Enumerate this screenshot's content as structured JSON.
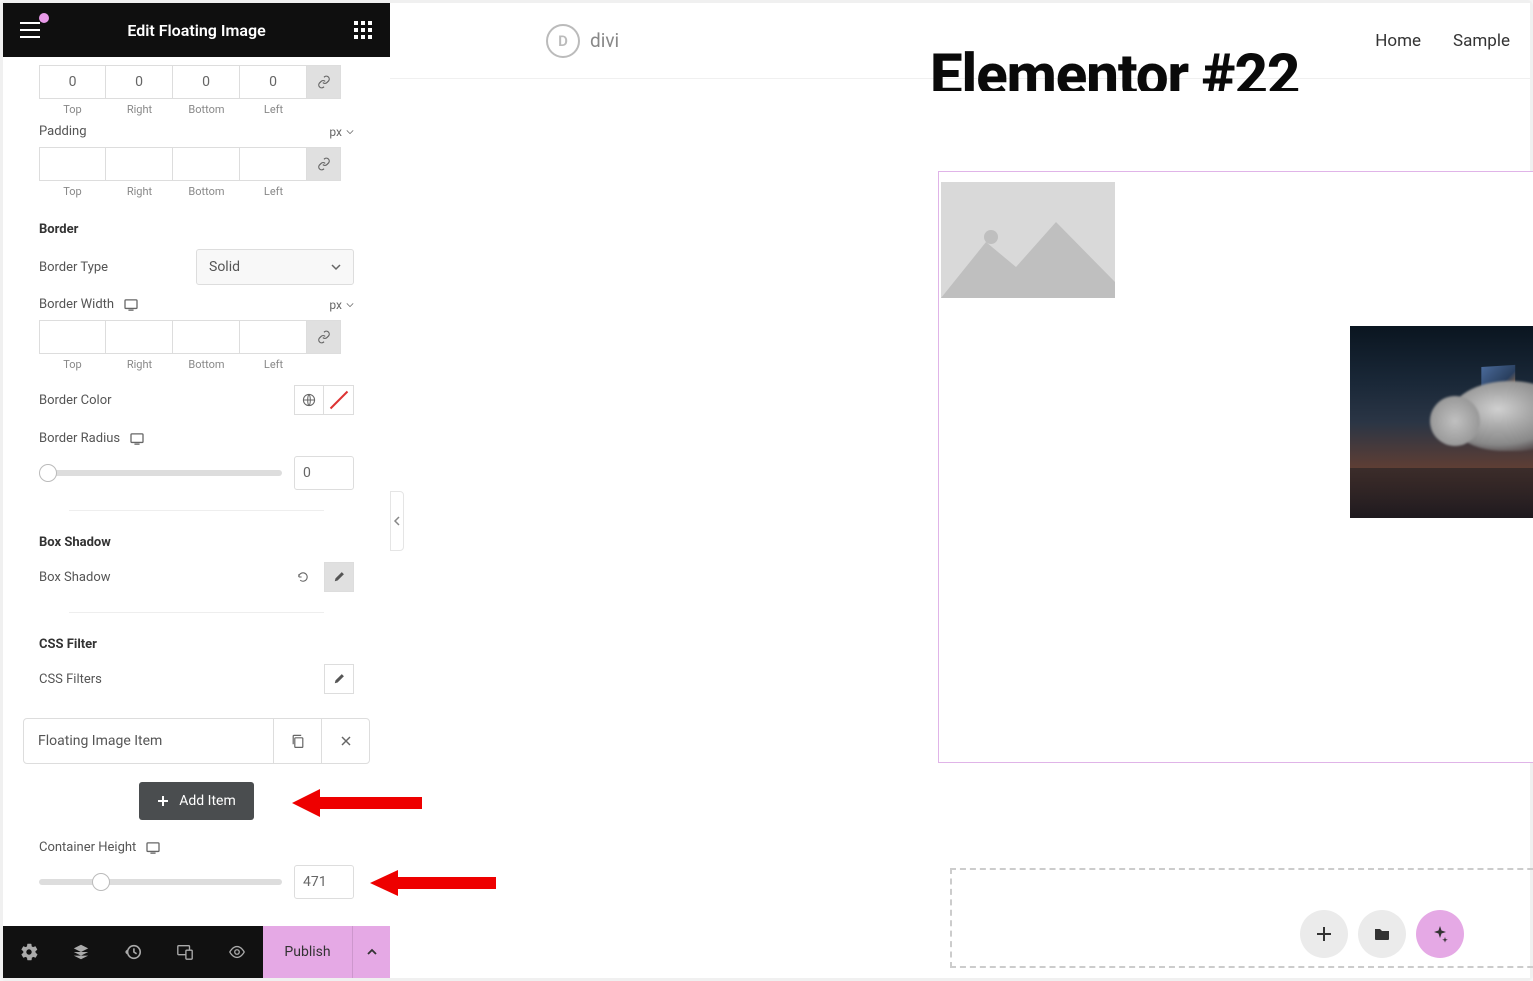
{
  "header": {
    "title": "Edit Floating Image"
  },
  "margin": {
    "top": "0",
    "right": "0",
    "bottom": "0",
    "left": "0",
    "labels": {
      "top": "Top",
      "right": "Right",
      "bottom": "Bottom",
      "left": "Left"
    }
  },
  "padding": {
    "label": "Padding",
    "unit": "px"
  },
  "border": {
    "title": "Border",
    "type_label": "Border Type",
    "type_value": "Solid",
    "width_label": "Border Width",
    "width_unit": "px",
    "color_label": "Border Color",
    "radius_label": "Border Radius",
    "radius_value": "0"
  },
  "boxshadow": {
    "title": "Box Shadow",
    "label": "Box Shadow"
  },
  "cssfilter": {
    "title": "CSS Filter",
    "label": "CSS Filters"
  },
  "imageItem": {
    "label": "Floating Image Item"
  },
  "addItem": {
    "label": "Add Item"
  },
  "containerHeight": {
    "label": "Container Height",
    "value": "471"
  },
  "footer": {
    "publish": "Publish"
  },
  "nav": {
    "home": "Home",
    "sample": "Sample"
  },
  "logo": {
    "text": "divi",
    "letter": "D"
  },
  "pageTitle": "Elementor #22"
}
